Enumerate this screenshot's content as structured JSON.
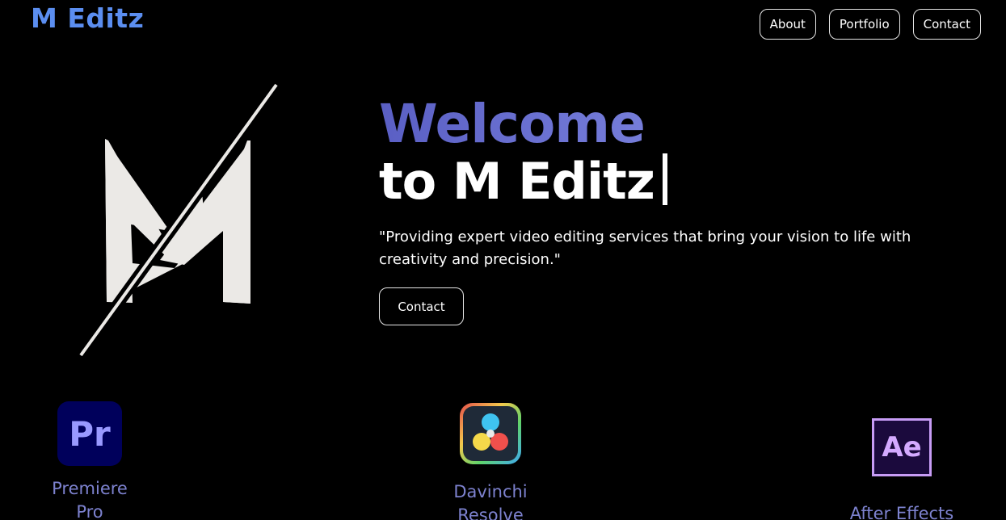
{
  "header": {
    "brand": "M Editz",
    "nav": [
      {
        "label": "About"
      },
      {
        "label": "Portfolio"
      },
      {
        "label": "Contact"
      }
    ]
  },
  "hero": {
    "welcome": "Welcome",
    "subtitle": "to M Editz",
    "tagline": "\"Providing expert video editing services that bring your vision to life with creativity and precision.\"",
    "cta_label": "Contact"
  },
  "tools": [
    {
      "name": "Premiere Pro",
      "icon": "premiere-pro-icon",
      "icon_text": "Pr"
    },
    {
      "name": "Davinchi Resolve",
      "icon": "davinci-resolve-icon"
    },
    {
      "name": "After Effects",
      "icon": "after-effects-icon",
      "icon_text": "Ae"
    }
  ],
  "colors": {
    "background": "#000000",
    "brand": "#5b8ef0",
    "tool_label": "#7d82cf"
  }
}
